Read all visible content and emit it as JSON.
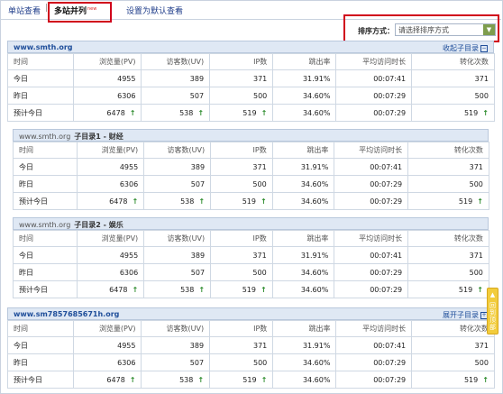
{
  "tabs": {
    "single": "单站查看",
    "separator": "|",
    "multi": "多站并列",
    "multi_badge": "new",
    "default": "设置为默认查看"
  },
  "sort": {
    "label": "排序方式：",
    "value": "请选择排序方式"
  },
  "columns": [
    "时间",
    "浏览量(PV)",
    "访客数(UV)",
    "IP数",
    "跳出率",
    "平均访问时长",
    "转化次数"
  ],
  "sections": [
    {
      "site": "www.smth.org",
      "sub": "",
      "toggle": "收起子目录",
      "rows": [
        {
          "label": "今日",
          "pv": "4955",
          "uv": "389",
          "ip": "371",
          "bounce": "31.91%",
          "avg": "00:07:41",
          "conv": "371"
        },
        {
          "label": "昨日",
          "pv": "6306",
          "uv": "507",
          "ip": "500",
          "bounce": "34.60%",
          "avg": "00:07:29",
          "conv": "500"
        },
        {
          "label": "预计今日",
          "pv": "6478",
          "uv": "538",
          "ip": "519",
          "bounce": "34.60%",
          "avg": "00:07:29",
          "conv": "519"
        }
      ]
    },
    {
      "site": "www.smth.org",
      "sub": "子目录1 - 财经",
      "toggle": "",
      "rows": [
        {
          "label": "今日",
          "pv": "4955",
          "uv": "389",
          "ip": "371",
          "bounce": "31.91%",
          "avg": "00:07:41",
          "conv": "371"
        },
        {
          "label": "昨日",
          "pv": "6306",
          "uv": "507",
          "ip": "500",
          "bounce": "34.60%",
          "avg": "00:07:29",
          "conv": "500"
        },
        {
          "label": "预计今日",
          "pv": "6478",
          "uv": "538",
          "ip": "519",
          "bounce": "34.60%",
          "avg": "00:07:29",
          "conv": "519"
        }
      ]
    },
    {
      "site": "www.smth.org",
      "sub": "子目录2 - 娱乐",
      "toggle": "",
      "rows": [
        {
          "label": "今日",
          "pv": "4955",
          "uv": "389",
          "ip": "371",
          "bounce": "31.91%",
          "avg": "00:07:41",
          "conv": "371"
        },
        {
          "label": "昨日",
          "pv": "6306",
          "uv": "507",
          "ip": "500",
          "bounce": "34.60%",
          "avg": "00:07:29",
          "conv": "500"
        },
        {
          "label": "预计今日",
          "pv": "6478",
          "uv": "538",
          "ip": "519",
          "bounce": "34.60%",
          "avg": "00:07:29",
          "conv": "519"
        }
      ]
    },
    {
      "site": "www.sm7857685671h.org",
      "sub": "",
      "toggle": "展开子目录",
      "rows": [
        {
          "label": "今日",
          "pv": "4955",
          "uv": "389",
          "ip": "371",
          "bounce": "31.91%",
          "avg": "00:07:41",
          "conv": "371"
        },
        {
          "label": "昨日",
          "pv": "6306",
          "uv": "507",
          "ip": "500",
          "bounce": "34.60%",
          "avg": "00:07:29",
          "conv": "500"
        },
        {
          "label": "预计今日",
          "pv": "6478",
          "uv": "538",
          "ip": "519",
          "bounce": "34.60%",
          "avg": "00:07:29",
          "conv": "519"
        }
      ]
    }
  ],
  "side_tab": "回到顶部",
  "colors": {
    "accent": "#1f4e9a",
    "header_bg": "#dfe8f4",
    "up_arrow": "#2a8a2a",
    "highlight": "#d0021b",
    "float_tab": "#f2cc3c"
  }
}
